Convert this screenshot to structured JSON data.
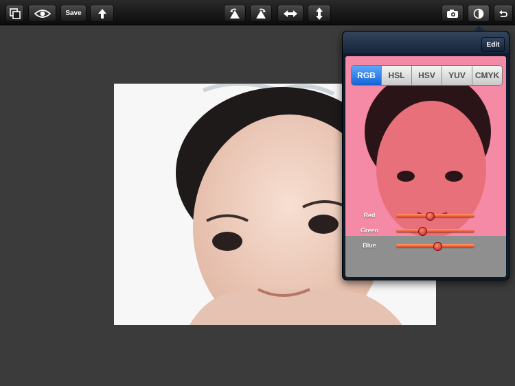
{
  "toolbar": {
    "save_label": "Save",
    "icons": [
      "layers-icon",
      "eye-icon",
      "share-up-arrow-icon",
      "rotate-left-icon",
      "rotate-right-icon",
      "flip-horizontal-icon",
      "flip-vertical-icon",
      "camera-icon",
      "contrast-icon",
      "undo-icon"
    ]
  },
  "popover": {
    "edit_label": "Edit",
    "color_modes": [
      "RGB",
      "HSL",
      "HSV",
      "YUV",
      "CMYK"
    ],
    "active_mode": "RGB",
    "sliders": [
      {
        "label": "Red",
        "value": 0.43
      },
      {
        "label": "Green",
        "value": 0.33
      },
      {
        "label": "Blue",
        "value": 0.53
      }
    ]
  },
  "colors": {
    "accent_blue": "#1f77e8",
    "slider_red": "#e0401b",
    "preview_tint": "#f48aa6"
  }
}
